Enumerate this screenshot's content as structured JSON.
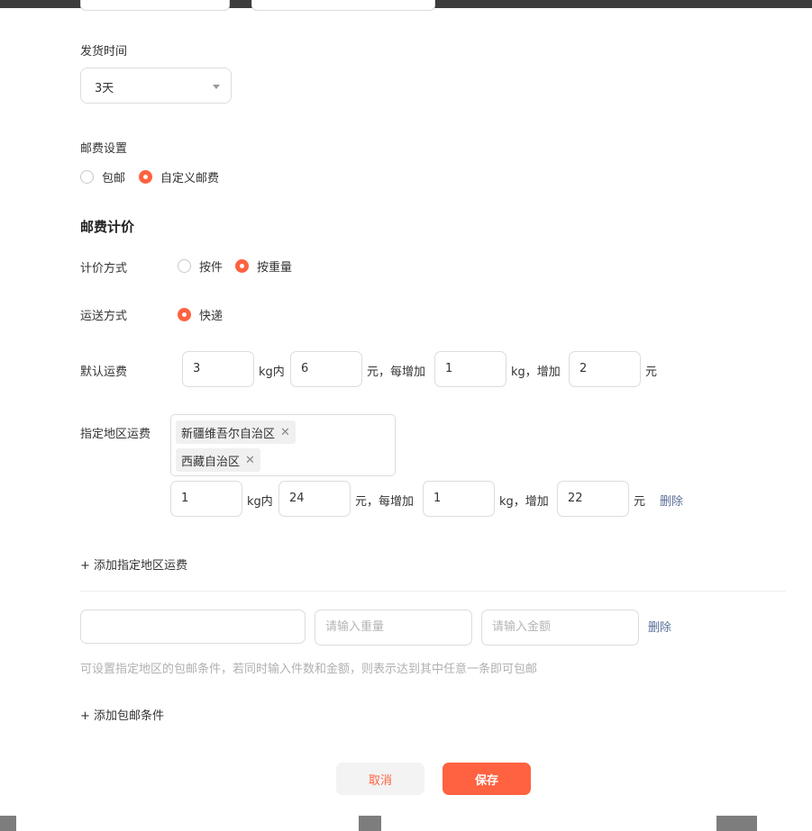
{
  "shipping_time": {
    "label": "发货时间",
    "value": "3天"
  },
  "postage_setting": {
    "label": "邮费设置",
    "options": [
      {
        "label": "包邮",
        "selected": false
      },
      {
        "label": "自定义邮费",
        "selected": true
      }
    ]
  },
  "postage_pricing": {
    "title": "邮费计价",
    "pricing_method": {
      "label": "计价方式",
      "options": [
        {
          "label": "按件",
          "selected": false
        },
        {
          "label": "按重量",
          "selected": true
        }
      ]
    },
    "delivery_method": {
      "label": "运送方式",
      "options": [
        {
          "label": "快递",
          "selected": true
        }
      ]
    },
    "default_fee": {
      "label": "默认运费",
      "first_weight": "3",
      "unit_within": "kg内",
      "first_fee": "6",
      "unit_each_add": "元，每增加",
      "add_weight": "1",
      "unit_add": "kg，增加",
      "add_fee": "2",
      "unit_yuan": "元"
    },
    "region_fee": {
      "label": "指定地区运费",
      "regions": [
        {
          "name": "新疆维吾尔自治区",
          "remove_icon": "close-icon"
        },
        {
          "name": "西藏自治区",
          "remove_icon": "close-icon"
        }
      ],
      "first_weight": "1",
      "unit_within": "kg内",
      "first_fee": "24",
      "unit_each_add": "元，每增加",
      "add_weight": "1",
      "unit_add": "kg，增加",
      "add_fee": "22",
      "unit_yuan": "元",
      "delete_label": "删除"
    },
    "add_region_label": "+ 添加指定地区运费"
  },
  "free_shipping": {
    "region_value": "",
    "weight_placeholder": "请输入重量",
    "amount_placeholder": "请输入金额",
    "delete_label": "删除",
    "hint": "可设置指定地区的包邮条件，若同时输入件数和金额，则表示达到其中任意一条即可包邮",
    "add_condition_label": "+ 添加包邮条件"
  },
  "actions": {
    "cancel": "取消",
    "save": "保存"
  },
  "colors": {
    "accent": "#ff6240",
    "link": "#5a6f99",
    "border": "#dcdcdc",
    "hint": "#b0b0b0"
  }
}
